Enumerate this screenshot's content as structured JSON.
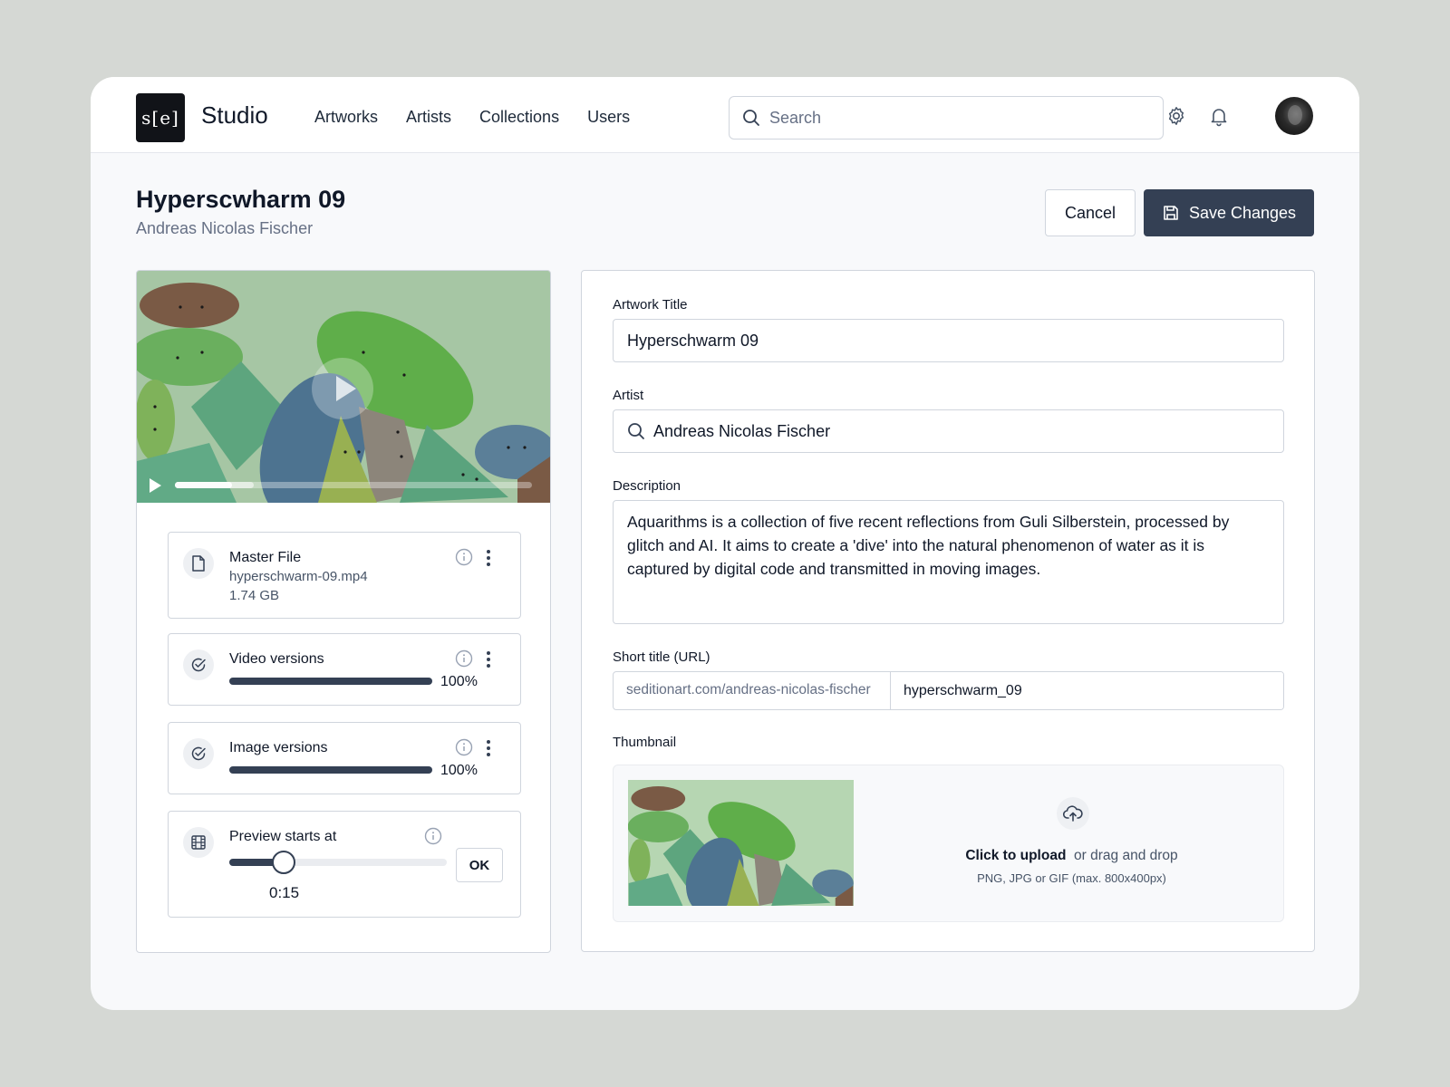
{
  "header": {
    "logo_text": "s[e]",
    "app_name": "Studio",
    "nav": [
      "Artworks",
      "Artists",
      "Collections",
      "Users"
    ],
    "search_placeholder": "Search",
    "icons": [
      "gear-icon",
      "bell-icon",
      "avatar"
    ]
  },
  "page": {
    "title": "Hyperscwharm 09",
    "subtitle": "Andreas Nicolas Fischer",
    "cancel_label": "Cancel",
    "save_label": "Save Changes"
  },
  "video": {
    "progress": 0.16,
    "buffered": 0.06
  },
  "files": {
    "master": {
      "title": "Master File",
      "filename": "hyperschwarm-09.mp4",
      "size": "1.74 GB"
    },
    "video_versions": {
      "title": "Video versions",
      "percent_label": "100%",
      "progress": 1.0
    },
    "image_versions": {
      "title": "Image versions",
      "percent_label": "100%",
      "progress": 1.0
    },
    "preview": {
      "title": "Preview starts at",
      "value": "0:15",
      "position": 0.25,
      "ok_label": "OK"
    }
  },
  "form": {
    "title_label": "Artwork Title",
    "title_value": "Hyperschwarm 09",
    "artist_label": "Artist",
    "artist_value": "Andreas Nicolas Fischer",
    "description_label": "Description",
    "description_value": "Aquarithms is a collection of five recent reflections from Guli Silberstein, processed by glitch and AI. It aims to create a 'dive' into the natural phenomenon of water as it is captured by digital code and transmitted in moving images.",
    "url_label": "Short title (URL)",
    "url_prefix": "seditionart.com/andreas-nicolas-fischer",
    "url_value": "hyperschwarm_09",
    "thumbnail_label": "Thumbnail",
    "upload_strong": "Click to upload",
    "upload_rest": "or drag and drop",
    "upload_hint": "PNG, JPG or GIF (max. 800x400px)"
  },
  "colors": {
    "accent": "#344054",
    "backdrop": "#d5d8d4",
    "window": "#f8f9fb"
  }
}
